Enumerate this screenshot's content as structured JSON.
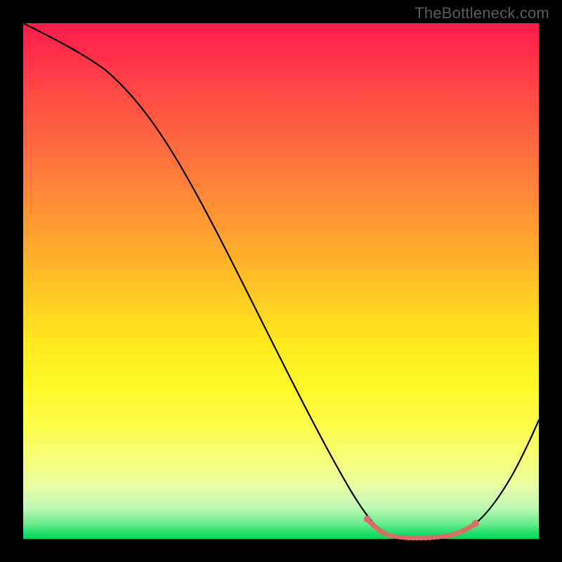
{
  "attribution": "TheBottleneck.com",
  "colors": {
    "frame": "#000000",
    "gradient_top": "#ff1a4a",
    "gradient_mid": "#ffe91f",
    "gradient_bottom": "#00d85e",
    "curve": "#000000",
    "highlight": "#dd6b68"
  },
  "chart_data": {
    "type": "line",
    "title": "",
    "xlabel": "",
    "ylabel": "",
    "xlim": [
      0,
      100
    ],
    "ylim": [
      0,
      100
    ],
    "x": [
      0,
      5,
      12,
      20,
      28,
      36,
      44,
      52,
      58,
      62,
      66,
      70,
      74,
      78,
      82,
      86,
      90,
      94,
      100
    ],
    "values": [
      100,
      98,
      95,
      88,
      77,
      64,
      50,
      36,
      24,
      15,
      8,
      3,
      1,
      0,
      0,
      1,
      4,
      11,
      30
    ],
    "highlight_range_x": [
      62,
      88
    ],
    "annotations": []
  }
}
